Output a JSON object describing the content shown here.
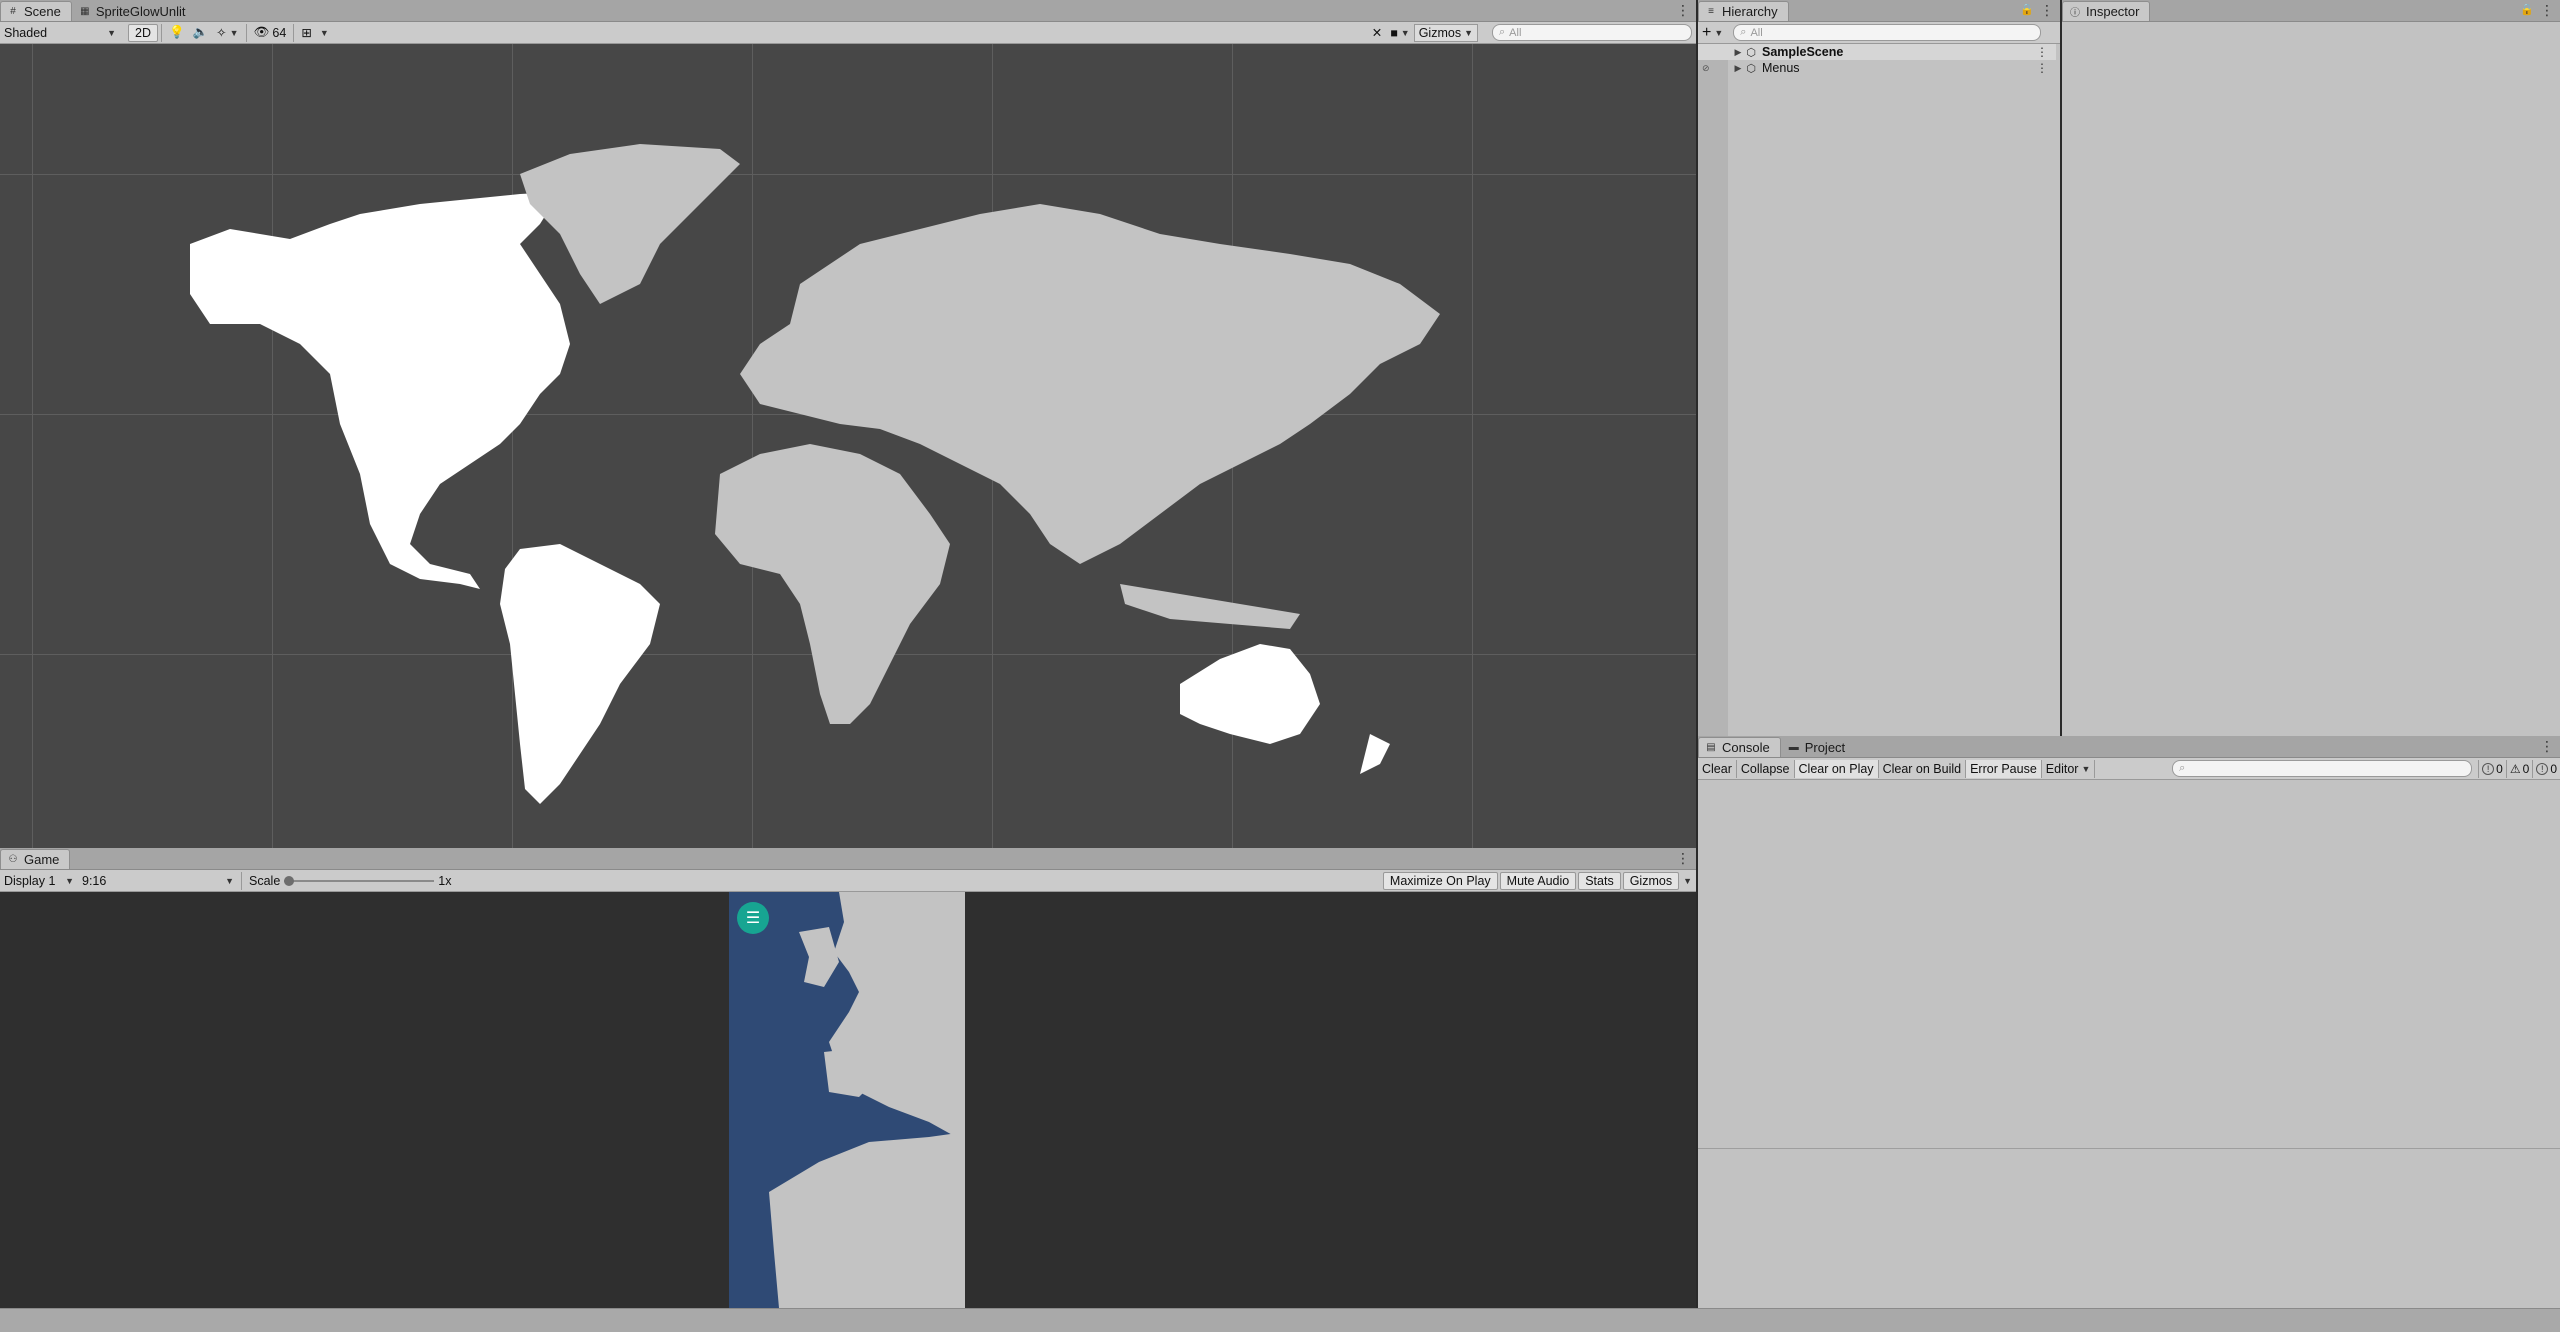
{
  "scene_panel": {
    "tabs": [
      {
        "label": "Scene",
        "icon": "hash-grid-icon"
      },
      {
        "label": "SpriteGlowUnlit",
        "icon": "animation-icon"
      }
    ],
    "toolbar": {
      "shading_mode": "Shaded",
      "mode_2d": "2D",
      "hidden_count": "64",
      "gizmos_label": "Gizmos",
      "search_placeholder": "All"
    }
  },
  "game_panel": {
    "tab_label": "Game",
    "toolbar": {
      "display": "Display 1",
      "aspect": "9:16",
      "scale_label": "Scale",
      "scale_value": "1x",
      "maximize_on_play": "Maximize On Play",
      "mute_audio": "Mute Audio",
      "stats": "Stats",
      "gizmos": "Gizmos"
    },
    "colors": {
      "ocean": "#2f4a75",
      "land": "#c3c3c3",
      "menu_button": "#17a592"
    }
  },
  "hierarchy_panel": {
    "tab_label": "Hierarchy",
    "search_placeholder": "All",
    "items": [
      {
        "label": "SampleScene",
        "bold": true
      },
      {
        "label": "Menus",
        "bold": false
      }
    ]
  },
  "inspector_panel": {
    "tab_label": "Inspector"
  },
  "console_panel": {
    "tabs": [
      {
        "label": "Console",
        "icon": "console-icon"
      },
      {
        "label": "Project",
        "icon": "folder-icon"
      }
    ],
    "buttons": {
      "clear": "Clear",
      "collapse": "Collapse",
      "clear_on_play": "Clear on Play",
      "clear_on_build": "Clear on Build",
      "error_pause": "Error Pause",
      "editor": "Editor"
    },
    "counts": {
      "info": "0",
      "warnings": "0",
      "errors": "0"
    }
  },
  "scene_colors": {
    "background": "#474747",
    "americas_land": "#ffffff",
    "other_land": "#c3c3c3"
  }
}
